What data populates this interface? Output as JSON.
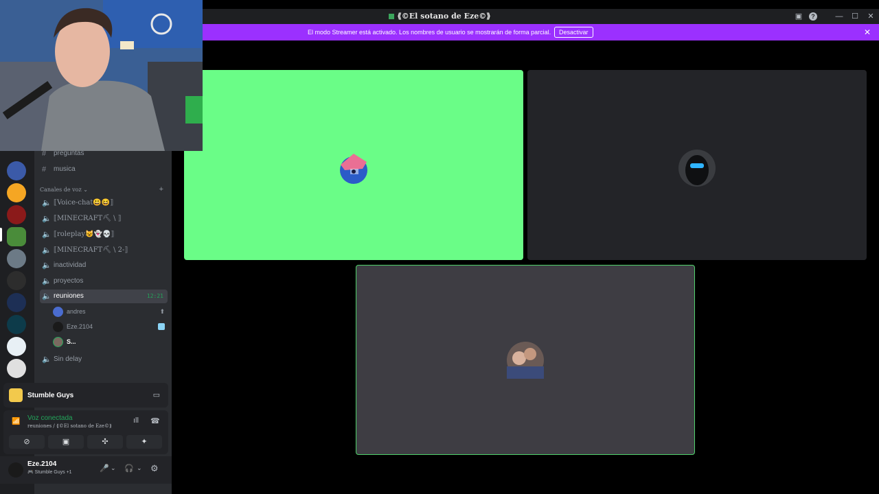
{
  "window": {
    "title": "⟪©El sotano de Eze©⟫"
  },
  "banner": {
    "message": "El modo Streamer está activado. Los nombres de usuario se mostrarán de forma parcial.",
    "button": "Desactivar",
    "close": "✕"
  },
  "channels": {
    "text": [
      {
        "name": "preguntas"
      },
      {
        "name": "musica"
      }
    ],
    "voice_category": "Canales de voz",
    "voice": [
      {
        "name": "⟦Voice-chat😃😆⟧"
      },
      {
        "name": "⟦MINECRAFT⛏ \\ ⟧"
      },
      {
        "name": "⟦roleplay😺👻💀⟧"
      },
      {
        "name": "⟦MINECRAFT⛏ \\ 2-⟧"
      },
      {
        "name": "inactividad"
      },
      {
        "name": "proyectos"
      },
      {
        "name": "reuniones",
        "time": "12:21"
      },
      {
        "name": "Sin delay"
      }
    ],
    "members": [
      {
        "name": "andres"
      },
      {
        "name": "Eze.2104"
      },
      {
        "name": "S..."
      }
    ]
  },
  "activity": {
    "game": "Stumble Guys"
  },
  "voice": {
    "status": "Voz conectada",
    "location": "reuniones / ⟪©El sotano de Eze©⟫"
  },
  "user": {
    "name": "Eze.2104",
    "status": "🎮 Stumble Guys +1"
  },
  "colors": {
    "accent": "#9b30ff",
    "green_tile": "#6afd87",
    "connected": "#23a55a"
  }
}
